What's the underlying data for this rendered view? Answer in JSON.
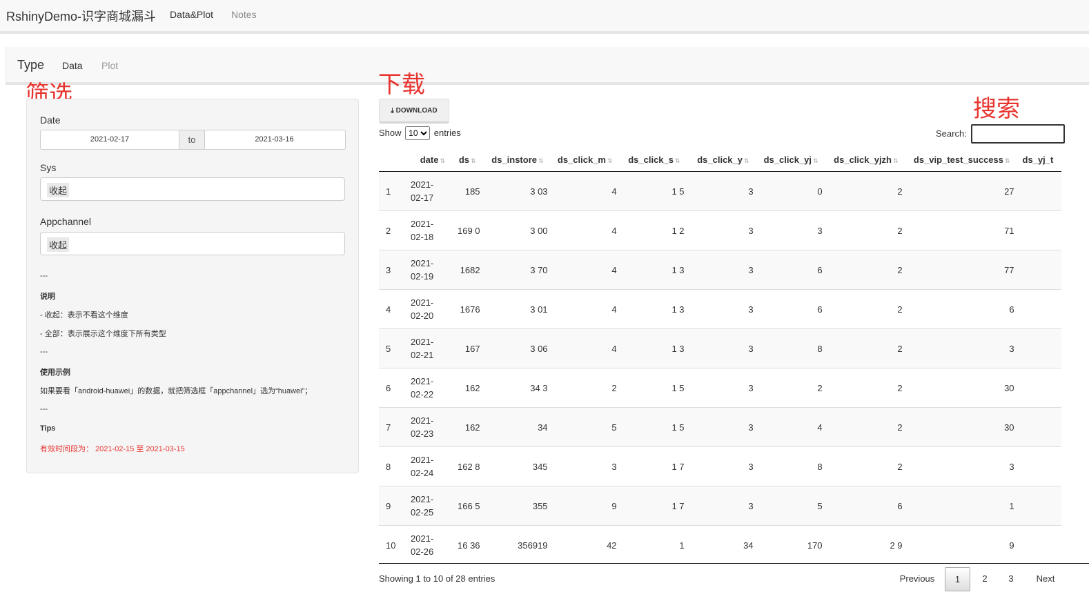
{
  "navbar": {
    "brand": "RshinyDemo-识字商城漏斗",
    "links": [
      "Data&Plot",
      "Notes"
    ]
  },
  "subnav": {
    "title": "Type",
    "tabs": [
      "Data",
      "Plot"
    ]
  },
  "annotations": {
    "filter": "筛选",
    "download": "下载",
    "search": "搜索"
  },
  "sidebar": {
    "date_label": "Date",
    "date_start": "2021-02-17",
    "date_sep": "to",
    "date_end": "2021-03-16",
    "sys_label": "Sys",
    "sys_value": "收起",
    "appchannel_label": "Appchannel",
    "appchannel_value": "收起",
    "notes": {
      "sep": "---",
      "heading1": "说明",
      "line1": "- 收起：表示不看这个维度",
      "line2": "- 全部：表示展示这个维度下所有类型",
      "heading2": "使用示例",
      "example": "如果要看「android-huawei」的数据，就把筛选框「appchannel」选为“huawei”；",
      "heading3": "Tips",
      "tip": "有效时间段为： 2021-02-15 至 2021-03-15"
    }
  },
  "download_label": "DOWNLOAD",
  "length": {
    "show": "Show",
    "value": "10",
    "entries": "entries"
  },
  "search_label": "Search:",
  "table": {
    "columns": [
      "date",
      "ds",
      "ds_instore",
      "ds_click_m",
      "ds_click_s",
      "ds_click_y",
      "ds_click_yj",
      "ds_click_yjzh",
      "ds_vip_test_success",
      "ds_yj_t"
    ],
    "rows": [
      [
        "1",
        "2021-",
        "02-17",
        "185",
        "3  03",
        "4",
        "1  5",
        "3",
        "0",
        "2",
        "27"
      ],
      [
        "2",
        "2021-",
        "02-18",
        "169  0",
        "3  00",
        "4",
        "1  2",
        "3",
        "3",
        "2",
        "71"
      ],
      [
        "3",
        "2021-",
        "02-19",
        "1682",
        "3  70",
        "4",
        "1  3",
        "3",
        "6",
        "2",
        "77"
      ],
      [
        "4",
        "2021-",
        "02-20",
        "1676",
        "3  01",
        "4",
        "1  3",
        "3",
        "6",
        "2",
        "6"
      ],
      [
        "5",
        "2021-",
        "02-21",
        "167",
        "3  06",
        "4",
        "1  3",
        "3",
        "8",
        "2",
        "3"
      ],
      [
        "6",
        "2021-",
        "02-22",
        "162",
        "34  3",
        "2",
        "1  5",
        "3",
        "2",
        "2",
        "30"
      ],
      [
        "7",
        "2021-",
        "02-23",
        "162",
        "34",
        "5",
        "1  5",
        "3",
        "4",
        "2",
        "30"
      ],
      [
        "8",
        "2021-",
        "02-24",
        "162  8",
        "345",
        "3",
        "1  7",
        "3",
        "8",
        "2",
        "3"
      ],
      [
        "9",
        "2021-",
        "02-25",
        "166  5",
        "355",
        "9",
        "1  7",
        "3",
        "5",
        "6",
        "1"
      ],
      [
        "10",
        "2021-",
        "02-26",
        "16  36",
        "356919",
        "42",
        "1",
        "34",
        "170",
        "2  9",
        "9"
      ]
    ]
  },
  "footer": {
    "info": "Showing 1 to 10 of 28 entries",
    "prev": "Previous",
    "pages": [
      "1",
      "2",
      "3"
    ],
    "next": "Next"
  }
}
